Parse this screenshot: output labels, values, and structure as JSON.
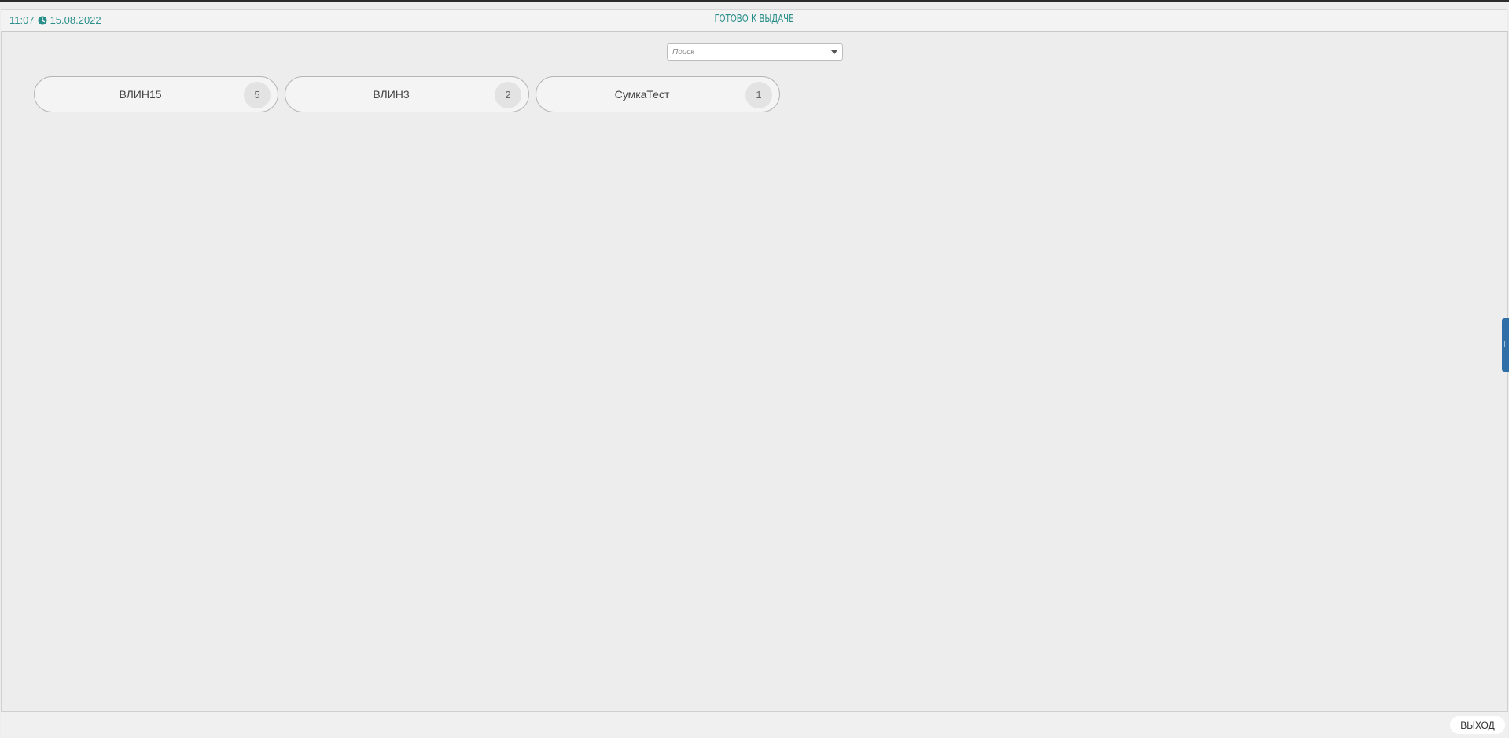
{
  "header": {
    "time": "11:07",
    "date": "15.08.2022",
    "title": "ГОТОВО К ВЫДАЧЕ"
  },
  "search": {
    "placeholder": "Поиск",
    "value": ""
  },
  "items": [
    {
      "label": "ВЛИН15",
      "count": "5"
    },
    {
      "label": "ВЛИН3",
      "count": "2"
    },
    {
      "label": "СумкаТест",
      "count": "1"
    }
  ],
  "footer": {
    "exit_label": "ВЫХОД"
  },
  "colors": {
    "accent": "#2a8f8a",
    "side_tab": "#2f6ea6",
    "background": "#ededed"
  },
  "icons": {
    "clock": "clock-icon",
    "dropdown": "chevron-down-icon",
    "side_panel": "side-panel-toggle-icon"
  }
}
